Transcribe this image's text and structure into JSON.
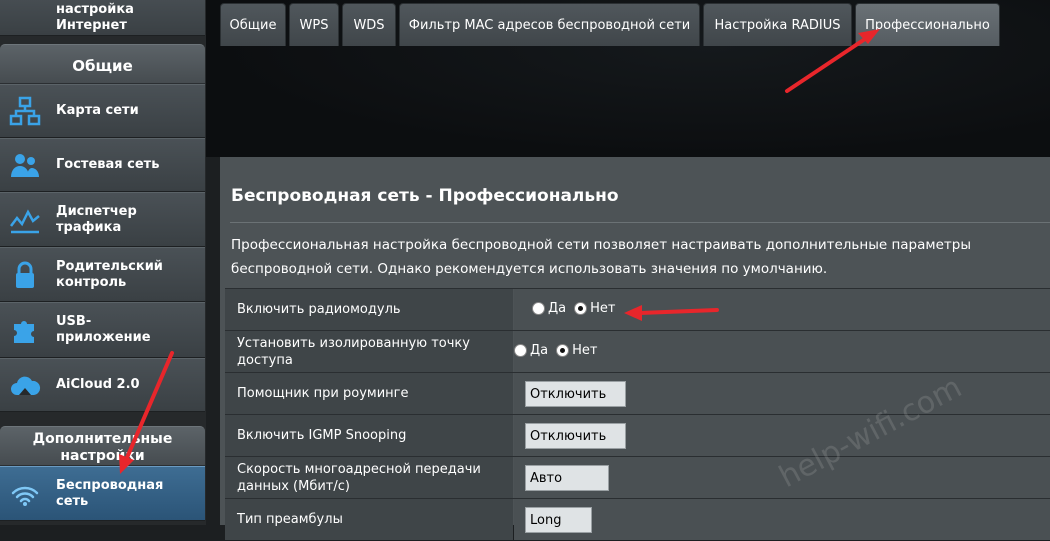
{
  "sidebar": {
    "top_item_label": "настройка\nИнтернет",
    "general_header": "Общие",
    "items": [
      {
        "label": "Карта сети",
        "icon": "network-map-icon"
      },
      {
        "label": "Гостевая сеть",
        "icon": "guest-network-icon"
      },
      {
        "label": "Диспетчер\nтрафика",
        "icon": "traffic-manager-icon"
      },
      {
        "label": "Родительский\nконтроль",
        "icon": "parental-lock-icon"
      },
      {
        "label": "USB-\nприложение",
        "icon": "usb-puzzle-icon"
      },
      {
        "label": "AiCloud 2.0",
        "icon": "cloud-icon"
      }
    ],
    "advanced_header": "Дополнительные\nнастройки",
    "active_item": {
      "label": "Беспроводная\nсеть",
      "icon": "wifi-icon"
    }
  },
  "tabs": [
    {
      "label": "Общие"
    },
    {
      "label": "WPS"
    },
    {
      "label": "WDS"
    },
    {
      "label": "Фильтр MAC адресов беспроводной сети"
    },
    {
      "label": "Настройка RADIUS"
    },
    {
      "label": "Профессионально",
      "active": true
    }
  ],
  "page": {
    "title": "Беспроводная сеть - Профессионально",
    "description": "Профессиональная настройка беспроводной сети позволяет настраивать дополнительные параметры беспроводной сети. Однако рекомендуется использовать значения по умолчанию."
  },
  "settings": [
    {
      "label": "Включить радиомодуль",
      "type": "radio",
      "options": [
        "Да",
        "Нет"
      ],
      "selected": "Нет"
    },
    {
      "label": "Установить изолированную точку доступа",
      "type": "radio",
      "options": [
        "Да",
        "Нет"
      ],
      "selected": "Нет"
    },
    {
      "label": "Помощник при роуминге",
      "type": "select",
      "value": "Отключить"
    },
    {
      "label": "Включить IGMP Snooping",
      "type": "select",
      "value": "Отключить"
    },
    {
      "label": "Скорость многоадресной передачи данных (Мбит/с)",
      "type": "select",
      "value": "Авто"
    },
    {
      "label": "Тип преамбулы",
      "type": "select",
      "value": "Long"
    }
  ],
  "watermark": "help-wifi.com",
  "colors": {
    "annotation_arrow": "#e8262b",
    "active_nav": "#2f5b80"
  }
}
